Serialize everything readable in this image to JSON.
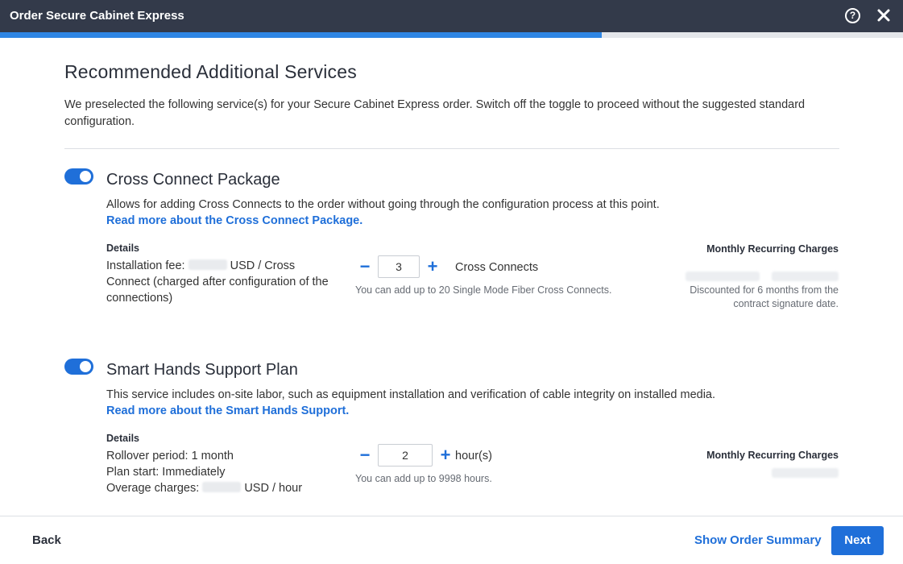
{
  "window": {
    "title": "Order Secure Cabinet Express",
    "help_icon": "help-circle-icon",
    "close_icon": "close-icon",
    "progress_fraction": 0.666
  },
  "page": {
    "title": "Recommended Additional Services",
    "intro": "We preselected the following service(s) for your Secure Cabinet Express order. Switch off the toggle to proceed without the suggested standard configuration."
  },
  "services": [
    {
      "enabled": true,
      "title": "Cross Connect Package",
      "description": "Allows for adding Cross Connects to the order without going through the configuration process at this point.",
      "link": "Read more about the Cross Connect Package.",
      "details_label": "Details",
      "details_prefix": "Installation fee:",
      "details_suffix": "USD / Cross Connect (charged after configuration of the connections)",
      "quantity": "3",
      "unit": "Cross Connects",
      "hint": "You can add up to 20 Single Mode Fiber Cross Connects.",
      "mrc_label": "Monthly Recurring Charges",
      "mrc_note": "Discounted for 6 months from the contract signature date."
    },
    {
      "enabled": true,
      "title": "Smart Hands Support Plan",
      "description": "This service includes on-site labor, such as equipment installation and verification of cable integrity on installed media.",
      "link": "Read more about the Smart Hands Support.",
      "details_label": "Details",
      "rollover": "Rollover period: 1 month",
      "plan_start": "Plan start: Immediately",
      "overage_prefix": "Overage charges:",
      "overage_suffix": "USD / hour",
      "quantity": "2",
      "unit": "hour(s)",
      "hint": "You can add up to 9998 hours.",
      "mrc_label": "Monthly Recurring Charges"
    }
  ],
  "footer": {
    "back": "Back",
    "show_summary": "Show Order Summary",
    "next": "Next"
  },
  "colors": {
    "titlebar": "#333a4a",
    "accent": "#1f6fd9",
    "progress": "#2f86e4"
  }
}
